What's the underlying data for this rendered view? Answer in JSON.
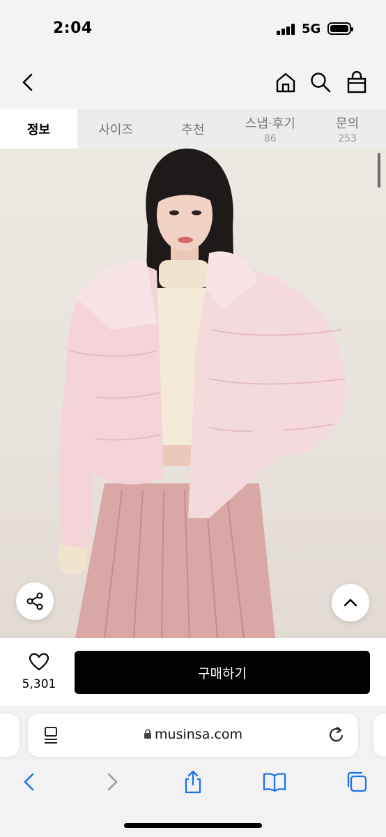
{
  "status": {
    "time": "2:04",
    "network": "5G"
  },
  "nav": {
    "back_icon": "chevron-left-icon",
    "home_icon": "home-icon",
    "search_icon": "search-icon",
    "cart_icon": "shopping-bag-icon"
  },
  "tabs": [
    {
      "label": "정보",
      "count": "",
      "active": true
    },
    {
      "label": "사이즈",
      "count": ""
    },
    {
      "label": "추천",
      "count": ""
    },
    {
      "label": "스냅·후기",
      "count": "86"
    },
    {
      "label": "문의",
      "count": "253"
    }
  ],
  "hero": {
    "share_icon": "share-icon",
    "scroll_top_icon": "chevron-up-icon"
  },
  "purchase": {
    "like_icon": "heart-icon",
    "like_count": "5,301",
    "buy_label": "구매하기"
  },
  "safari": {
    "url": "musinsa.com",
    "reader_icon": "page-menu-icon",
    "lock_icon": "lock-icon",
    "reload_icon": "reload-icon",
    "toolbar": [
      "back-icon",
      "forward-icon",
      "share-icon",
      "bookmarks-icon",
      "tabs-icon"
    ]
  },
  "colors": {
    "accent": "#000000",
    "tab_inactive_bg": "#ececec",
    "page_bg": "#f3f3f3",
    "jacket": "#f3d4d8",
    "skirt": "#d9a8a6"
  }
}
